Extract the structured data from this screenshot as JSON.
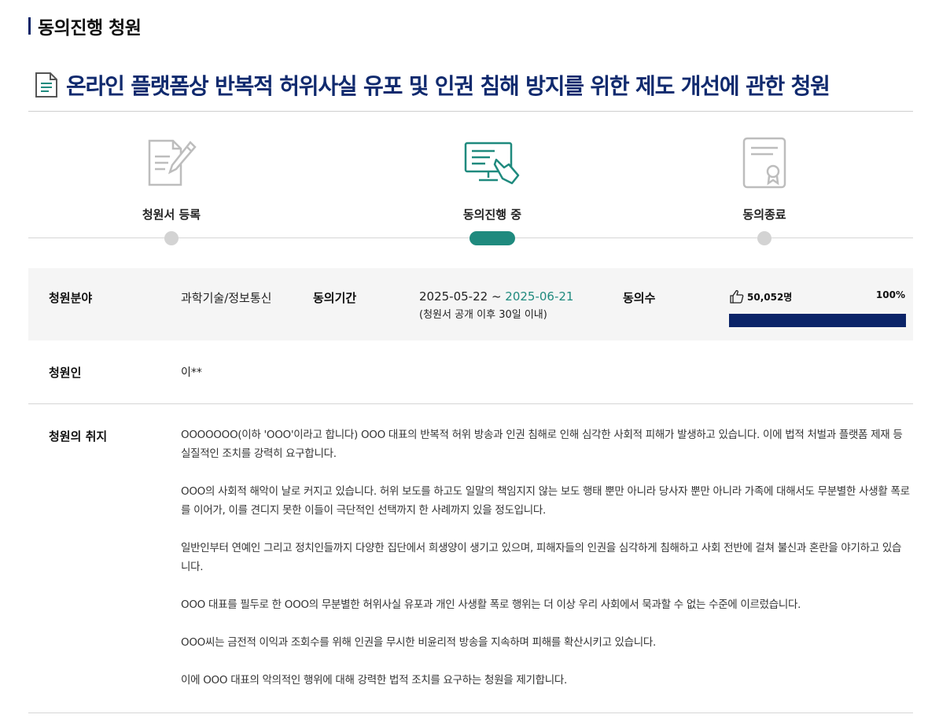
{
  "section": {
    "title": "동의진행 청원"
  },
  "petition": {
    "title": "온라인 플랫폼상 반복적 허위사실 유포 및 인권 침해 방지를 위한 제도 개선에 관한 청원"
  },
  "steps": [
    {
      "label": "청원서 등록",
      "icon": "document-pen-icon",
      "active": false
    },
    {
      "label": "동의진행 중",
      "icon": "monitor-hand-icon",
      "active": true
    },
    {
      "label": "동의종료",
      "icon": "certificate-icon",
      "active": false
    }
  ],
  "info": {
    "field_label": "청원분야",
    "field_value": "과학기술/정보통신",
    "period_label": "동의기간",
    "period_start": "2025-05-22",
    "period_sep": " ~ ",
    "period_end": "2025-06-21",
    "period_note": "(청원서 공개 이후 30일 이내)",
    "count_label": "동의수",
    "count_value": "50,052명",
    "percent": "100%",
    "progress_fraction": 1.0,
    "accent_color": "#1f8a7e",
    "bar_color": "#0b2468"
  },
  "petitioner": {
    "label": "청원인",
    "value": "이**"
  },
  "purpose": {
    "label": "청원의 취지",
    "paragraphs": [
      "OOOOOOO(이하 'OOO'이라고 합니다) OOO 대표의 반복적 허위 방송과 인권 침해로 인해 심각한 사회적 피해가 발생하고 있습니다. 이에 법적 처벌과 플랫폼 제재 등 실질적인 조치를 강력히 요구합니다.",
      "OOO의 사회적 해악이 날로 커지고 있습니다. 허위 보도를 하고도 일말의 책임지지 않는 보도 행태 뿐만 아니라 당사자 뿐만 아니라 가족에 대해서도 무분별한 사생활 폭로를 이어가, 이를 견디지 못한 이들이 극단적인 선택까지 한 사례까지 있을 정도입니다.",
      "일반인부터 연예인 그리고 정치인들까지 다양한 집단에서 희생양이 생기고 있으며, 피해자들의 인권을 심각하게 침해하고 사회 전반에 걸쳐 불신과 혼란을 야기하고 있습니다.",
      "OOO 대표를 필두로 한 OOO의 무분별한 허위사실 유포과 개인 사생활 폭로 행위는 더 이상 우리 사회에서 묵과할 수 없는 수준에 이르렀습니다.",
      "OOO씨는 금전적 이익과 조회수를 위해 인권을 무시한 비윤리적 방송을 지속하며 피해를 확산시키고 있습니다.",
      "이에 OOO 대표의 악의적인 행위에 대해 강력한 법적 조치를 요구하는 청원을 제기합니다."
    ]
  }
}
